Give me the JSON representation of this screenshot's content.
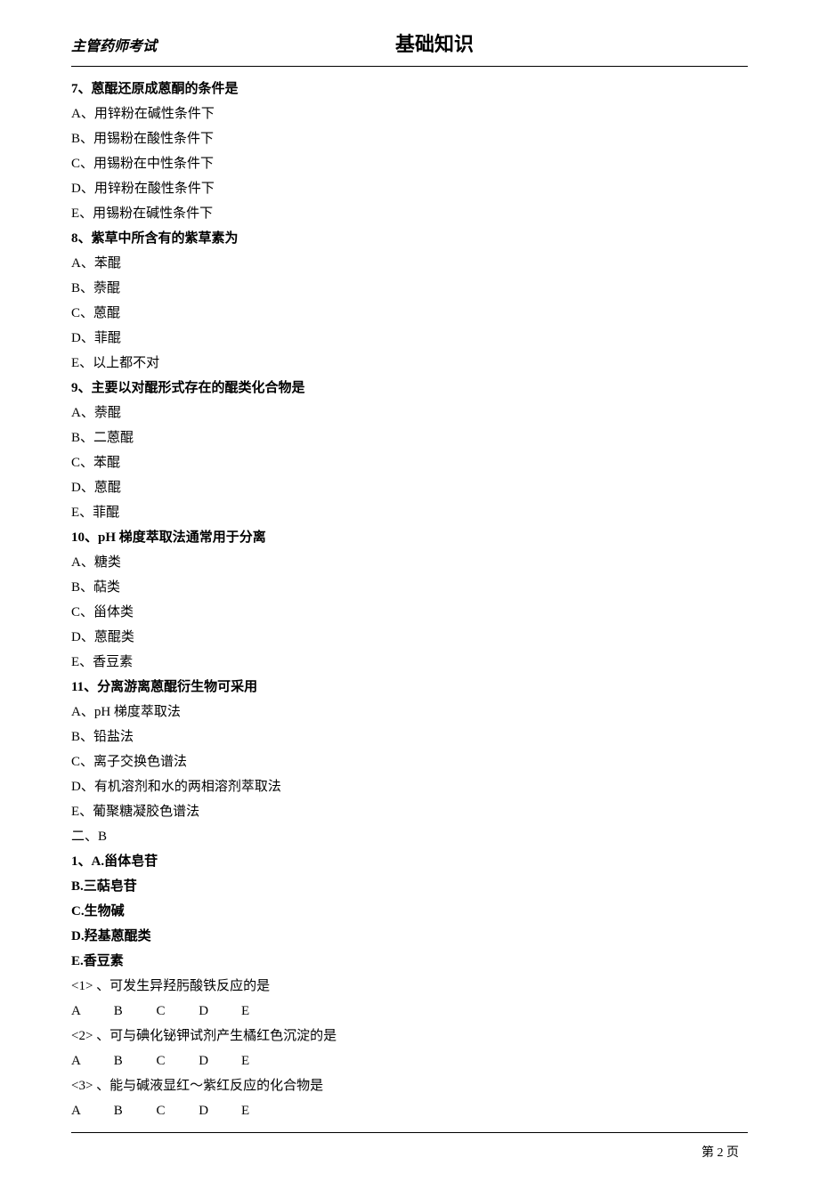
{
  "header": {
    "left": "主管药师考试",
    "center": "基础知识"
  },
  "q7": {
    "stem": "7、蒽醌还原成蒽酮的条件是",
    "a": "A、用锌粉在碱性条件下",
    "b": "B、用锡粉在酸性条件下",
    "c": "C、用锡粉在中性条件下",
    "d": "D、用锌粉在酸性条件下",
    "e": "E、用锡粉在碱性条件下"
  },
  "q8": {
    "stem": "8、紫草中所含有的紫草素为",
    "a": "A、苯醌",
    "b": "B、萘醌",
    "c": "C、蒽醌",
    "d": "D、菲醌",
    "e": "E、以上都不对"
  },
  "q9": {
    "stem": "9、主要以对醌形式存在的醌类化合物是",
    "a": "A、萘醌",
    "b": "B、二蒽醌",
    "c": "C、苯醌",
    "d": "D、蒽醌",
    "e": "E、菲醌"
  },
  "q10": {
    "stem": "10、pH 梯度萃取法通常用于分离",
    "a": "A、糖类",
    "b": "B、萜类",
    "c": "C、甾体类",
    "d": "D、蒽醌类",
    "e": "E、香豆素"
  },
  "q11": {
    "stem": "11、分离游离蒽醌衍生物可采用",
    "a": "A、pH 梯度萃取法",
    "b": "B、铅盐法",
    "c": "C、离子交换色谱法",
    "d": "D、有机溶剂和水的两相溶剂萃取法",
    "e": "E、葡聚糖凝胶色谱法"
  },
  "sectionB": {
    "label": "二、B",
    "q1": {
      "stem": "1、A.甾体皂苷",
      "b": "B.三萜皂苷",
      "c": "C.生物碱",
      "d": "D.羟基蒽醌类",
      "e": "E.香豆素"
    },
    "sub1": "<1>  、可发生异羟肟酸铁反应的是",
    "sub2": "<2>  、可与碘化铋钾试剂产生橘红色沉淀的是",
    "sub3": "<3>  、能与碱液显红～紫红反应的化合物是",
    "options": {
      "a": "A",
      "b": "B",
      "c": "C",
      "d": "D",
      "e": "E"
    }
  },
  "footer": {
    "page": "第 2 页"
  }
}
